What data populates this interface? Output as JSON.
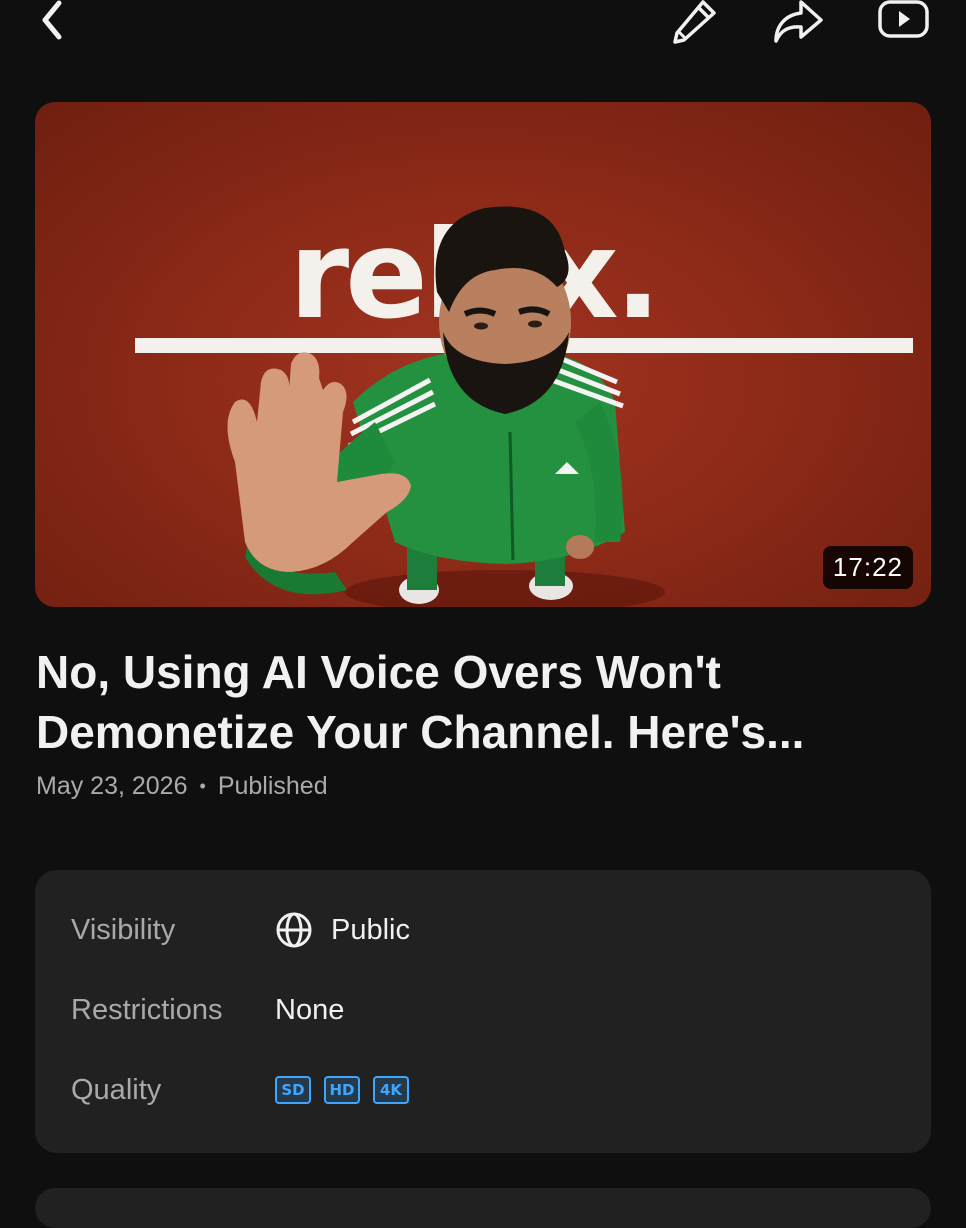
{
  "toolbar": {
    "back_icon": "chevron-left-icon",
    "edit_icon": "pencil-icon",
    "share_icon": "share-arrow-icon",
    "watch_icon": "youtube-play-icon"
  },
  "video": {
    "thumbnail_text": "relax.",
    "duration": "17:22",
    "title": "No, Using AI Voice Overs Won't\nDemonetize Your Channel. Here's...",
    "date": "May 23, 2026",
    "separator": "•",
    "status": "Published"
  },
  "details": {
    "visibility": {
      "label": "Visibility",
      "value": "Public",
      "icon": "globe-icon"
    },
    "restrictions": {
      "label": "Restrictions",
      "value": "None"
    },
    "quality": {
      "label": "Quality",
      "badges": [
        "SD",
        "HD",
        "4K"
      ]
    }
  },
  "colors": {
    "background": "#0f0f0f",
    "card": "#212121",
    "accent": "#3ea6ff",
    "thumbnail_bg": "#8e2a18"
  }
}
